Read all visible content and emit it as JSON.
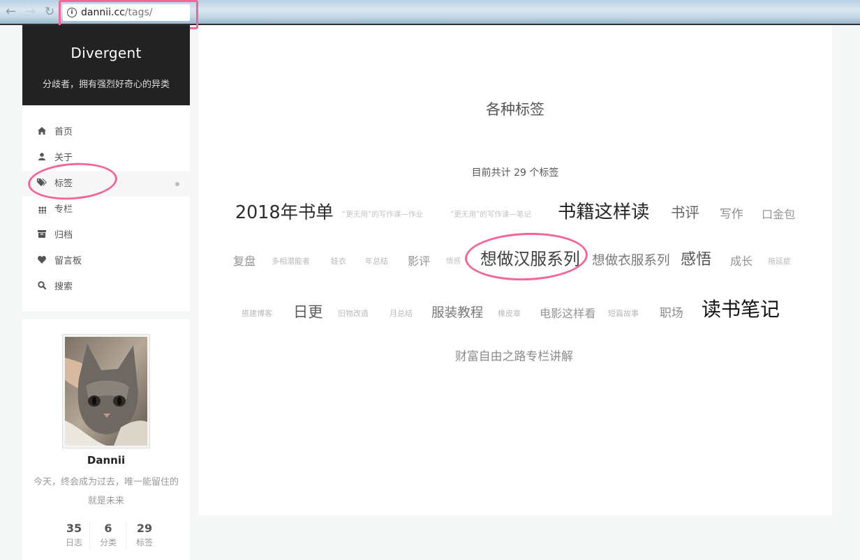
{
  "browser": {
    "url_host": "dannii.cc",
    "url_path": "/tags/",
    "back_icon": "arrow-left-icon",
    "forward_icon": "arrow-right-icon",
    "reload_icon": "reload-icon",
    "highlight_color": "#f0679a"
  },
  "site": {
    "title": "Divergent",
    "subtitle": "分歧者，拥有强烈好奇心的异类"
  },
  "menu": {
    "items": [
      {
        "label": "首页",
        "icon": "home-icon"
      },
      {
        "label": "关于",
        "icon": "user-icon"
      },
      {
        "label": "标签",
        "icon": "tags-icon",
        "active": true
      },
      {
        "label": "专栏",
        "icon": "grid-icon"
      },
      {
        "label": "归档",
        "icon": "archive-icon"
      },
      {
        "label": "留言板",
        "icon": "heart-icon"
      },
      {
        "label": "搜索",
        "icon": "search-icon"
      }
    ]
  },
  "author": {
    "name": "Dannii",
    "motto": "今天，终会成为过去，唯一能留住的就是未来",
    "stats": [
      {
        "num": "35",
        "label": "日志"
      },
      {
        "num": "6",
        "label": "分类"
      },
      {
        "num": "29",
        "label": "标签"
      }
    ]
  },
  "main": {
    "title": "各种标签",
    "count_text": "目前共计 29 个标签",
    "tags": [
      {
        "label": "2018年书单",
        "weight": 0.85
      },
      {
        "label": "“更无用”的写作课—作业",
        "weight": 0.05
      },
      {
        "label": "“更无用”的写作课—笔记",
        "weight": 0.05
      },
      {
        "label": "书籍这样读",
        "weight": 0.9
      },
      {
        "label": "书评",
        "weight": 0.55
      },
      {
        "label": "写作",
        "weight": 0.35
      },
      {
        "label": "口金包",
        "weight": 0.3
      },
      {
        "label": "复盘",
        "weight": 0.3
      },
      {
        "label": "多相潜能者",
        "weight": 0.1
      },
      {
        "label": "娃衣",
        "weight": 0.1
      },
      {
        "label": "年总结",
        "weight": 0.1
      },
      {
        "label": "影评",
        "weight": 0.3
      },
      {
        "label": "情感",
        "weight": 0.05
      },
      {
        "label": "想做汉服系列",
        "weight": 0.75
      },
      {
        "label": "想做衣服系列",
        "weight": 0.45
      },
      {
        "label": "感悟",
        "weight": 0.65
      },
      {
        "label": "成长",
        "weight": 0.3
      },
      {
        "label": "拖延症",
        "weight": 0.1
      },
      {
        "label": "搭建博客",
        "weight": 0.1
      },
      {
        "label": "日更",
        "weight": 0.6
      },
      {
        "label": "旧物改造",
        "weight": 0.1
      },
      {
        "label": "月总结",
        "weight": 0.1
      },
      {
        "label": "服装教程",
        "weight": 0.45
      },
      {
        "label": "橡皮章",
        "weight": 0.1
      },
      {
        "label": "电影这样看",
        "weight": 0.3
      },
      {
        "label": "短篇故事",
        "weight": 0.1
      },
      {
        "label": "职场",
        "weight": 0.35
      },
      {
        "label": "读书笔记",
        "weight": 1.0
      },
      {
        "label": "财富自由之路专栏讲解",
        "weight": 0.35
      }
    ]
  }
}
